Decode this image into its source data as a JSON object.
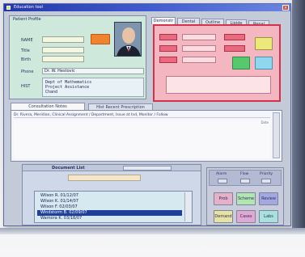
{
  "window": {
    "title": "Education tool"
  },
  "patient_panel": {
    "header": "Patient Profile",
    "fields": [
      {
        "label": "NAME",
        "value": ""
      },
      {
        "label": "Title",
        "value": ""
      },
      {
        "label": "Birth",
        "value": ""
      },
      {
        "label": "Phone",
        "value": "Dr. W. Hestovic"
      }
    ],
    "badge_label": "",
    "notes_label": "HIST",
    "notes_lines": [
      "Dept of Mathematics",
      "Project Assistance",
      "Chand"
    ]
  },
  "detail_panel": {
    "tabs": [
      "Demonstr",
      "Dental",
      "Outline",
      "Lipide",
      "Renal"
    ],
    "row_labels": [
      "",
      "",
      ""
    ],
    "side_labels": [
      "",
      ""
    ],
    "button_yellow": "",
    "button_green": "",
    "button_cyan": ""
  },
  "middle_panel": {
    "tabs": [
      "Consultation Notes",
      "Hist Recent Prescription"
    ],
    "summary": "Dr. Rivera, Meridian, Clinical Assignment / Department, Issue at Ind, Monitor / Follow",
    "scroll_text": "Date"
  },
  "document_panel": {
    "header": "Document List",
    "search_placeholder": "",
    "rows": [
      "Wilson R. 01/12/07",
      "Wilson K. 01/14/07",
      "Wilson F. 02/03/07",
      "Windstorm B. 02/09/07",
      "Wamora K. 03/18/07"
    ],
    "selected_index": 3,
    "colors": {
      "selected": "#1f3f9a",
      "list_bg": "#d6e8f0"
    }
  },
  "action_panel": {
    "headers": [
      "Alarm",
      "Flow",
      "Priority"
    ],
    "buttons": [
      {
        "label": "Prob",
        "color": "#e6b0c8"
      },
      {
        "label": "Scheme",
        "color": "#b2e6b0"
      },
      {
        "label": "Review",
        "color": "#a4a8e0"
      },
      {
        "label": "Demand",
        "color": "#e8e2a2"
      },
      {
        "label": "Cases",
        "color": "#e2a8d4"
      },
      {
        "label": "Labs",
        "color": "#a8e2de"
      }
    ]
  },
  "colors": {
    "titlebar": "#2c45b8",
    "patient_panel": "#cfe8dc",
    "detail_border": "#d2334a",
    "detail_fill": "#f4b7c2",
    "orange_badge": "#f0832e"
  }
}
